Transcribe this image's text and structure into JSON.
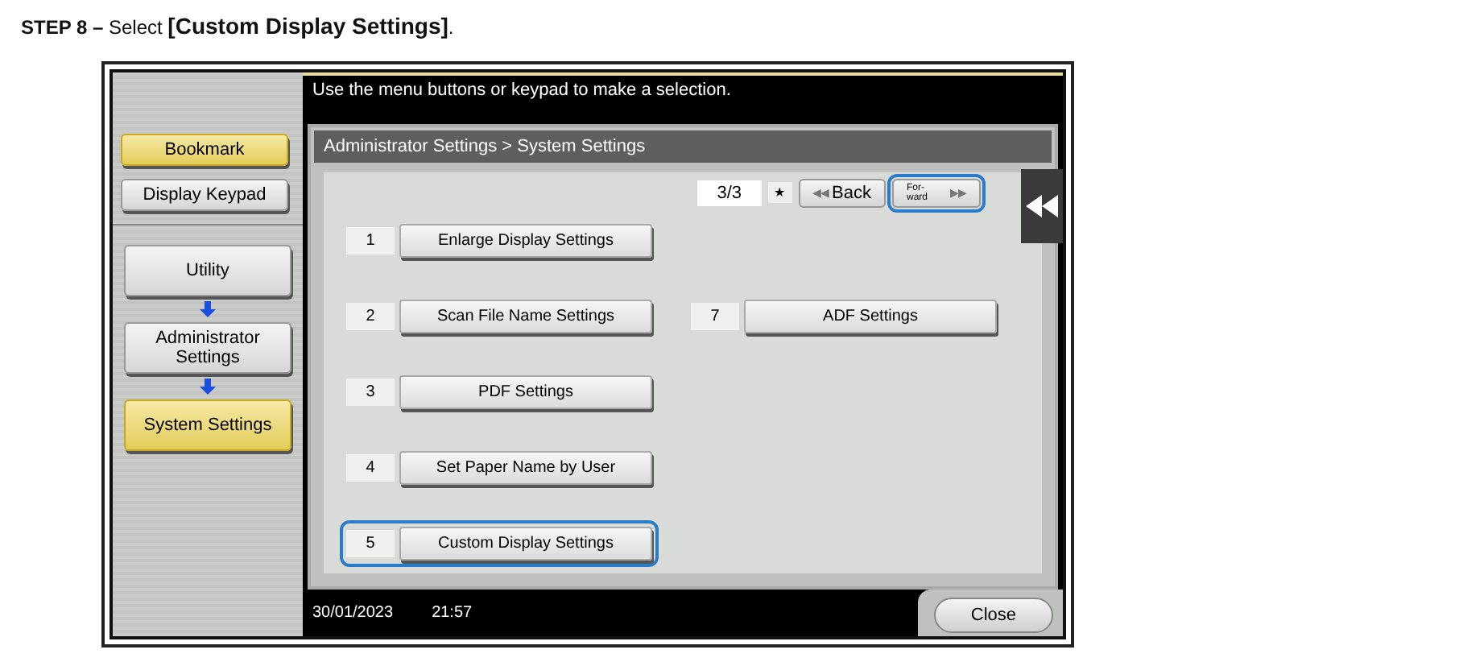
{
  "step": {
    "label": "STEP 8 –",
    "text": "Select ",
    "target": "[Custom Display Settings]",
    "end": "."
  },
  "screen": {
    "message": "Use the menu buttons or keypad to make a selection.",
    "sidebar": {
      "top": [
        {
          "label": "Bookmark",
          "highlighted": true
        },
        {
          "label": "Display Keypad",
          "highlighted": false
        }
      ],
      "path": [
        {
          "label": "Utility",
          "highlighted": false
        },
        {
          "label": "Administrator Settings",
          "highlighted": false
        },
        {
          "label": "System Settings",
          "highlighted": true
        }
      ]
    },
    "breadcrumb": "Administrator Settings > System Settings",
    "page": "3/3",
    "star": "★",
    "back": {
      "icon": "◀◀",
      "label": "Back",
      "highlighted": false
    },
    "forward": {
      "label": "For-\nward",
      "icon": "▶▶",
      "highlighted": true
    },
    "rows": [
      [
        {
          "number": "1",
          "label": "Enlarge Display Settings",
          "highlighted": false
        }
      ],
      [
        {
          "number": "2",
          "label": "Scan File Name Settings",
          "highlighted": false
        },
        {
          "number": "7",
          "label": "ADF Settings",
          "highlighted": false
        }
      ],
      [
        {
          "number": "3",
          "label": "PDF Settings",
          "highlighted": false
        }
      ],
      [
        {
          "number": "4",
          "label": "Set Paper Name by User",
          "highlighted": false
        }
      ],
      [
        {
          "number": "5",
          "label": "Custom Display Settings",
          "highlighted": true
        }
      ]
    ],
    "date": "30/01/2023",
    "time": "21:57",
    "close": "Close"
  }
}
